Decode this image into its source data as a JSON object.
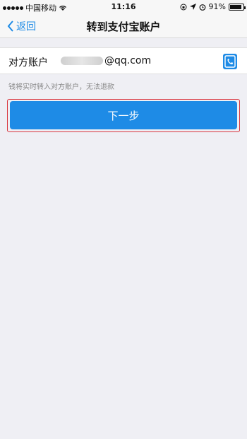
{
  "status_bar": {
    "carrier": "中国移动",
    "time": "11:16",
    "battery": "91%",
    "battery_level": 0.91
  },
  "nav": {
    "back_label": "返回",
    "title": "转到支付宝账户"
  },
  "account": {
    "label": "对方账户",
    "value_suffix": "@qq.com"
  },
  "hint": "钱将实时转入对方账户，无法退款",
  "next_button_label": "下一步",
  "colors": {
    "accent": "#1e8be6",
    "highlight_border": "#d9363e"
  }
}
